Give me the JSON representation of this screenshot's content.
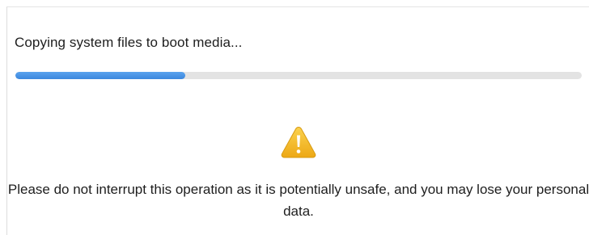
{
  "operation": {
    "status_text": "Copying system files to boot media...",
    "progress_percent": 30,
    "progress_color": "#3b87de",
    "track_color": "#e3e3e3"
  },
  "warning": {
    "icon": "warning-icon",
    "icon_color": "#f2b21a",
    "message": "Please do not interrupt this operation as it is potentially unsafe, and you may lose your personal data."
  }
}
